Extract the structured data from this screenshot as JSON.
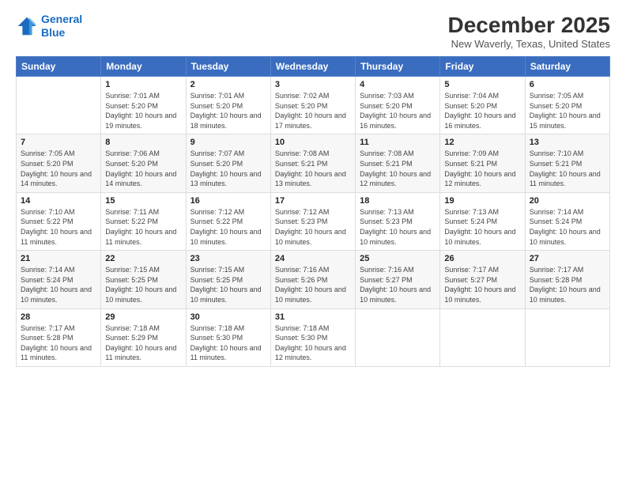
{
  "logo": {
    "line1": "General",
    "line2": "Blue"
  },
  "title": "December 2025",
  "subtitle": "New Waverly, Texas, United States",
  "headers": [
    "Sunday",
    "Monday",
    "Tuesday",
    "Wednesday",
    "Thursday",
    "Friday",
    "Saturday"
  ],
  "weeks": [
    [
      {
        "day": "",
        "sunrise": "",
        "sunset": "",
        "daylight": ""
      },
      {
        "day": "1",
        "sunrise": "Sunrise: 7:01 AM",
        "sunset": "Sunset: 5:20 PM",
        "daylight": "Daylight: 10 hours and 19 minutes."
      },
      {
        "day": "2",
        "sunrise": "Sunrise: 7:01 AM",
        "sunset": "Sunset: 5:20 PM",
        "daylight": "Daylight: 10 hours and 18 minutes."
      },
      {
        "day": "3",
        "sunrise": "Sunrise: 7:02 AM",
        "sunset": "Sunset: 5:20 PM",
        "daylight": "Daylight: 10 hours and 17 minutes."
      },
      {
        "day": "4",
        "sunrise": "Sunrise: 7:03 AM",
        "sunset": "Sunset: 5:20 PM",
        "daylight": "Daylight: 10 hours and 16 minutes."
      },
      {
        "day": "5",
        "sunrise": "Sunrise: 7:04 AM",
        "sunset": "Sunset: 5:20 PM",
        "daylight": "Daylight: 10 hours and 16 minutes."
      },
      {
        "day": "6",
        "sunrise": "Sunrise: 7:05 AM",
        "sunset": "Sunset: 5:20 PM",
        "daylight": "Daylight: 10 hours and 15 minutes."
      }
    ],
    [
      {
        "day": "7",
        "sunrise": "Sunrise: 7:05 AM",
        "sunset": "Sunset: 5:20 PM",
        "daylight": "Daylight: 10 hours and 14 minutes."
      },
      {
        "day": "8",
        "sunrise": "Sunrise: 7:06 AM",
        "sunset": "Sunset: 5:20 PM",
        "daylight": "Daylight: 10 hours and 14 minutes."
      },
      {
        "day": "9",
        "sunrise": "Sunrise: 7:07 AM",
        "sunset": "Sunset: 5:20 PM",
        "daylight": "Daylight: 10 hours and 13 minutes."
      },
      {
        "day": "10",
        "sunrise": "Sunrise: 7:08 AM",
        "sunset": "Sunset: 5:21 PM",
        "daylight": "Daylight: 10 hours and 13 minutes."
      },
      {
        "day": "11",
        "sunrise": "Sunrise: 7:08 AM",
        "sunset": "Sunset: 5:21 PM",
        "daylight": "Daylight: 10 hours and 12 minutes."
      },
      {
        "day": "12",
        "sunrise": "Sunrise: 7:09 AM",
        "sunset": "Sunset: 5:21 PM",
        "daylight": "Daylight: 10 hours and 12 minutes."
      },
      {
        "day": "13",
        "sunrise": "Sunrise: 7:10 AM",
        "sunset": "Sunset: 5:21 PM",
        "daylight": "Daylight: 10 hours and 11 minutes."
      }
    ],
    [
      {
        "day": "14",
        "sunrise": "Sunrise: 7:10 AM",
        "sunset": "Sunset: 5:22 PM",
        "daylight": "Daylight: 10 hours and 11 minutes."
      },
      {
        "day": "15",
        "sunrise": "Sunrise: 7:11 AM",
        "sunset": "Sunset: 5:22 PM",
        "daylight": "Daylight: 10 hours and 11 minutes."
      },
      {
        "day": "16",
        "sunrise": "Sunrise: 7:12 AM",
        "sunset": "Sunset: 5:22 PM",
        "daylight": "Daylight: 10 hours and 10 minutes."
      },
      {
        "day": "17",
        "sunrise": "Sunrise: 7:12 AM",
        "sunset": "Sunset: 5:23 PM",
        "daylight": "Daylight: 10 hours and 10 minutes."
      },
      {
        "day": "18",
        "sunrise": "Sunrise: 7:13 AM",
        "sunset": "Sunset: 5:23 PM",
        "daylight": "Daylight: 10 hours and 10 minutes."
      },
      {
        "day": "19",
        "sunrise": "Sunrise: 7:13 AM",
        "sunset": "Sunset: 5:24 PM",
        "daylight": "Daylight: 10 hours and 10 minutes."
      },
      {
        "day": "20",
        "sunrise": "Sunrise: 7:14 AM",
        "sunset": "Sunset: 5:24 PM",
        "daylight": "Daylight: 10 hours and 10 minutes."
      }
    ],
    [
      {
        "day": "21",
        "sunrise": "Sunrise: 7:14 AM",
        "sunset": "Sunset: 5:24 PM",
        "daylight": "Daylight: 10 hours and 10 minutes."
      },
      {
        "day": "22",
        "sunrise": "Sunrise: 7:15 AM",
        "sunset": "Sunset: 5:25 PM",
        "daylight": "Daylight: 10 hours and 10 minutes."
      },
      {
        "day": "23",
        "sunrise": "Sunrise: 7:15 AM",
        "sunset": "Sunset: 5:25 PM",
        "daylight": "Daylight: 10 hours and 10 minutes."
      },
      {
        "day": "24",
        "sunrise": "Sunrise: 7:16 AM",
        "sunset": "Sunset: 5:26 PM",
        "daylight": "Daylight: 10 hours and 10 minutes."
      },
      {
        "day": "25",
        "sunrise": "Sunrise: 7:16 AM",
        "sunset": "Sunset: 5:27 PM",
        "daylight": "Daylight: 10 hours and 10 minutes."
      },
      {
        "day": "26",
        "sunrise": "Sunrise: 7:17 AM",
        "sunset": "Sunset: 5:27 PM",
        "daylight": "Daylight: 10 hours and 10 minutes."
      },
      {
        "day": "27",
        "sunrise": "Sunrise: 7:17 AM",
        "sunset": "Sunset: 5:28 PM",
        "daylight": "Daylight: 10 hours and 10 minutes."
      }
    ],
    [
      {
        "day": "28",
        "sunrise": "Sunrise: 7:17 AM",
        "sunset": "Sunset: 5:28 PM",
        "daylight": "Daylight: 10 hours and 11 minutes."
      },
      {
        "day": "29",
        "sunrise": "Sunrise: 7:18 AM",
        "sunset": "Sunset: 5:29 PM",
        "daylight": "Daylight: 10 hours and 11 minutes."
      },
      {
        "day": "30",
        "sunrise": "Sunrise: 7:18 AM",
        "sunset": "Sunset: 5:30 PM",
        "daylight": "Daylight: 10 hours and 11 minutes."
      },
      {
        "day": "31",
        "sunrise": "Sunrise: 7:18 AM",
        "sunset": "Sunset: 5:30 PM",
        "daylight": "Daylight: 10 hours and 12 minutes."
      },
      {
        "day": "",
        "sunrise": "",
        "sunset": "",
        "daylight": ""
      },
      {
        "day": "",
        "sunrise": "",
        "sunset": "",
        "daylight": ""
      },
      {
        "day": "",
        "sunrise": "",
        "sunset": "",
        "daylight": ""
      }
    ]
  ]
}
